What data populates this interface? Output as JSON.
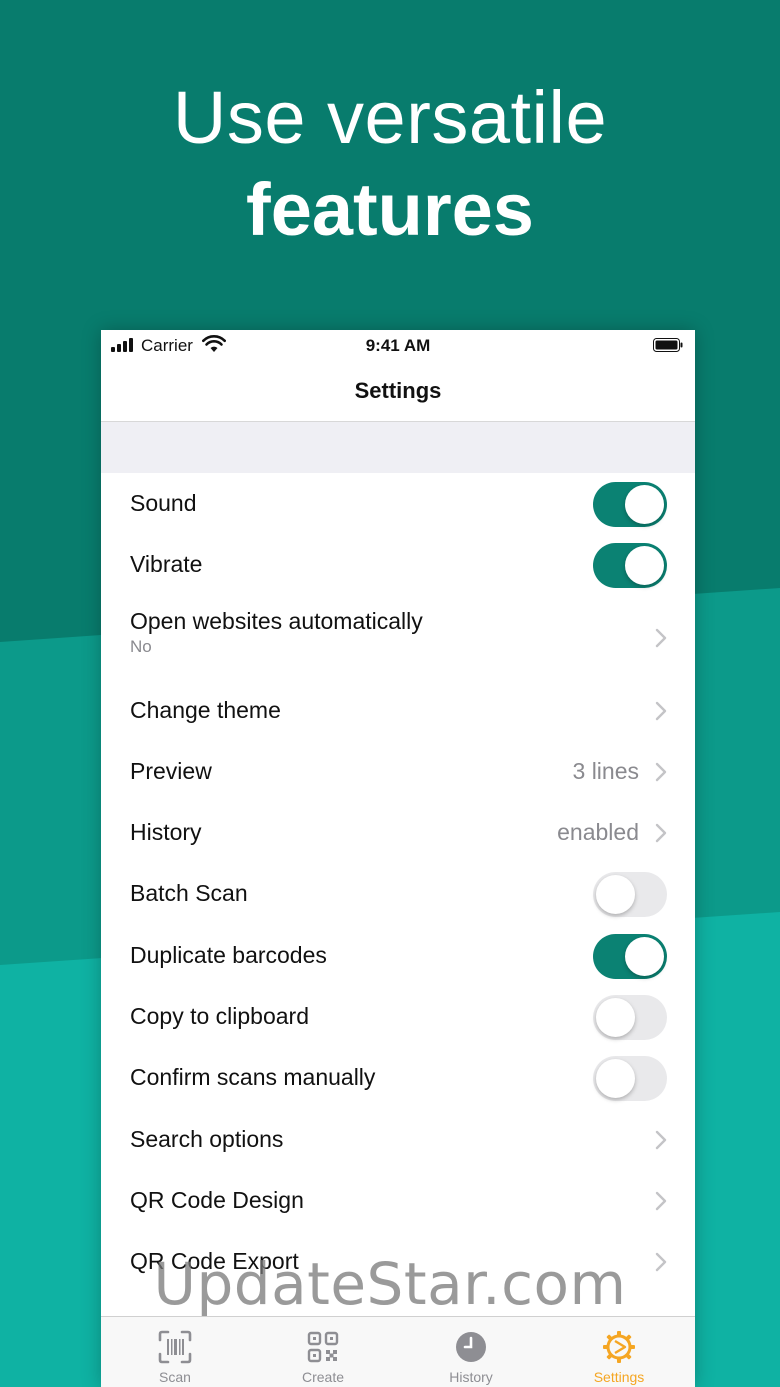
{
  "promo": {
    "headline_line1": "Use versatile",
    "headline_line2": "features"
  },
  "statusbar": {
    "carrier": "Carrier",
    "time": "9:41 AM"
  },
  "navbar": {
    "title": "Settings"
  },
  "settings": [
    {
      "label": "Sound",
      "type": "toggle",
      "on": true
    },
    {
      "label": "Vibrate",
      "type": "toggle",
      "on": true
    },
    {
      "label": "Open websites automatically",
      "sub": "No",
      "type": "link"
    },
    {
      "label": "Change theme",
      "type": "link"
    },
    {
      "label": "Preview",
      "value": "3 lines",
      "type": "link"
    },
    {
      "label": "History",
      "value": "enabled",
      "type": "link"
    },
    {
      "label": "Batch Scan",
      "type": "toggle",
      "on": false
    },
    {
      "label": "Duplicate barcodes",
      "type": "toggle",
      "on": true
    },
    {
      "label": "Copy to clipboard",
      "type": "toggle",
      "on": false
    },
    {
      "label": "Confirm scans manually",
      "type": "toggle",
      "on": false
    },
    {
      "label": "Search options",
      "type": "link"
    },
    {
      "label": "QR Code Design",
      "type": "link"
    },
    {
      "label": "QR Code Export",
      "type": "link"
    }
  ],
  "tabs": [
    {
      "label": "Scan",
      "icon": "scan-icon",
      "active": false
    },
    {
      "label": "Create",
      "icon": "qr-code-icon",
      "active": false
    },
    {
      "label": "History",
      "icon": "clock-icon",
      "active": false
    },
    {
      "label": "Settings",
      "icon": "gear-icon",
      "active": true
    }
  ],
  "watermark": "UpdateStar.com",
  "colors": {
    "accent": "#0b8273",
    "active_tab": "#f5a623",
    "background": "#087c6d"
  }
}
